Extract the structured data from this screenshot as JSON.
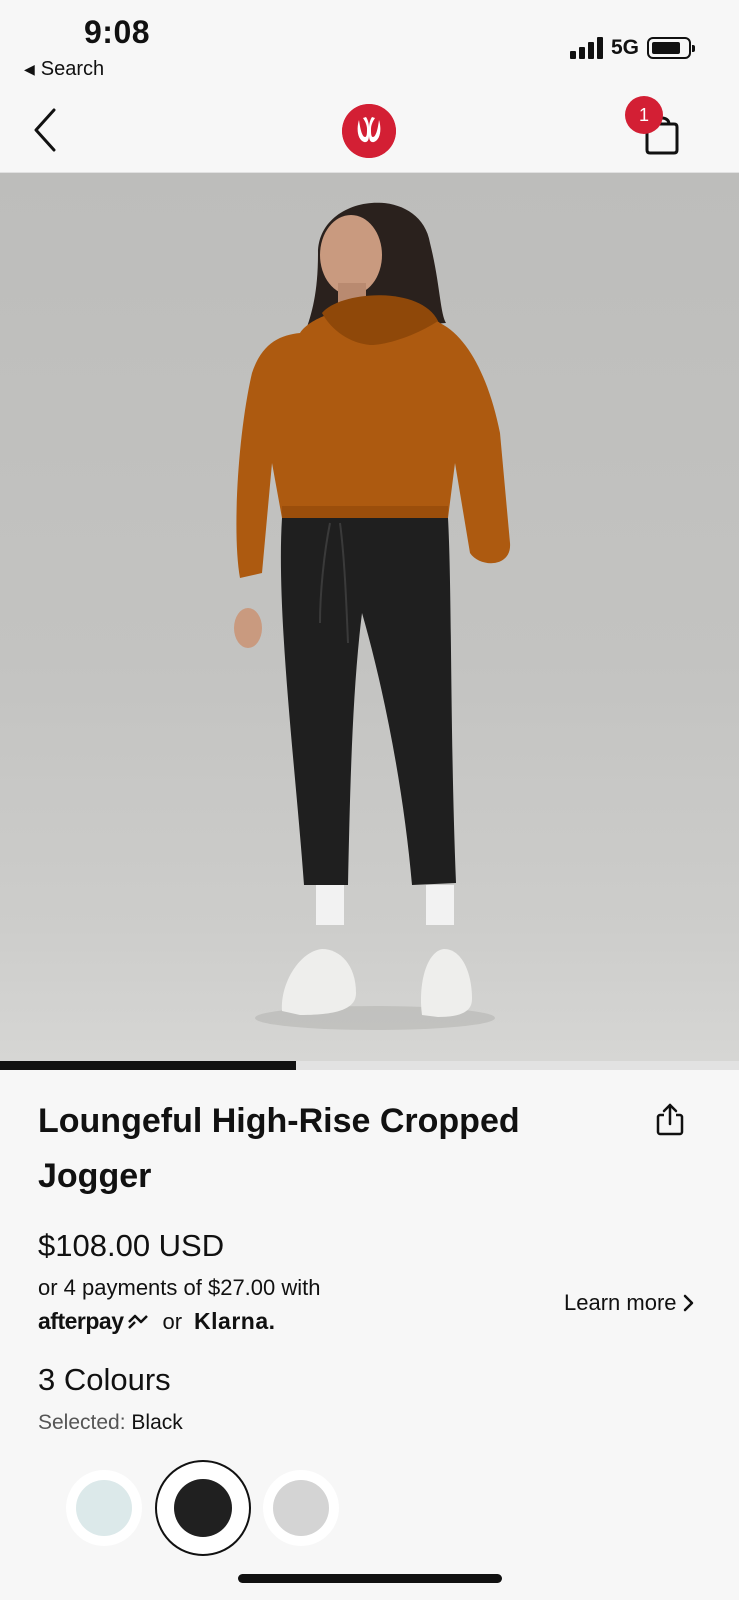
{
  "status": {
    "time": "9:08",
    "back_app": "Search",
    "network": "5G"
  },
  "header": {
    "cart_count": "1"
  },
  "gallery": {
    "progress": 0.4
  },
  "product": {
    "title": "Loungeful High-Rise Cropped Jogger",
    "price": "$108.00 USD",
    "installment": "or 4 payments of $27.00 with",
    "afterpay": "afterpay",
    "or": "or",
    "klarna": "Klarna.",
    "learn_more": "Learn more",
    "colour_count": "3 Colours",
    "selected_label": "Selected:",
    "selected_value": "Black",
    "swatches": [
      {
        "name": "light-blue",
        "color": "#dce9ea",
        "selected": false
      },
      {
        "name": "black",
        "color": "#202020",
        "selected": true
      },
      {
        "name": "heathered-grey",
        "color": "#d4d4d4",
        "selected": false
      }
    ]
  },
  "colors": {
    "brand_red": "#d31f34"
  }
}
